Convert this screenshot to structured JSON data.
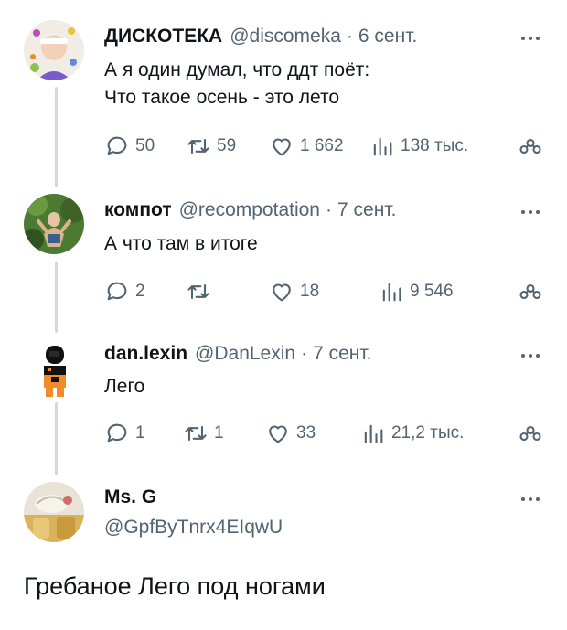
{
  "tweets": [
    {
      "name": "ДИСКОТЕКА",
      "handle": "@discomeka",
      "date": "6 сент.",
      "lines": [
        "А я один думал, что ддт поёт:",
        "Что такое осень - это лето"
      ],
      "replies": "50",
      "retweets": "59",
      "likes": "1 662",
      "views": "138 тыс."
    },
    {
      "name": "компот",
      "handle": "@recompotation",
      "date": "7 сент.",
      "lines": [
        "А что там в итоге"
      ],
      "replies": "2",
      "retweets": "",
      "likes": "18",
      "views": "9 546"
    },
    {
      "name": "dan.lexin",
      "handle": "@DanLexin",
      "date": "7 сент.",
      "lines": [
        "Лего"
      ],
      "replies": "1",
      "retweets": "1",
      "likes": "33",
      "views": "21,2 тыс."
    },
    {
      "name": "Ms. G",
      "handle": "@GpfByTnrx4EIqwU",
      "text": "Гребаное Лего под ногами"
    }
  ],
  "separator": "·",
  "icons": {
    "reply": "reply-icon",
    "retweet": "retweet-icon",
    "like": "heart-icon",
    "views": "views-chart-icon",
    "share": "share-icon",
    "more": "more-dots-icon"
  },
  "colors": {
    "text": "#0f1419",
    "secondary": "#536471",
    "thread_line": "#cfd9de"
  }
}
